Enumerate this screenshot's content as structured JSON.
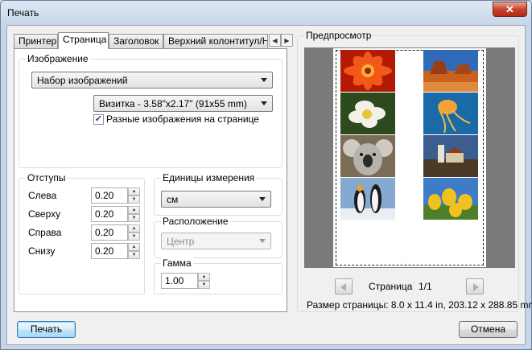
{
  "window": {
    "title": "Печать",
    "close_glyph": "✕"
  },
  "tabs": [
    {
      "label": "Принтер",
      "active": false
    },
    {
      "label": "Страница",
      "active": true
    },
    {
      "label": "Заголовок",
      "active": false
    },
    {
      "label": "Верхний колонтитул/Ни",
      "active": false
    }
  ],
  "image_group": {
    "label": "Изображение",
    "mode_value": "Набор изображений",
    "size_value": "Визитка - 3.58\"x2.17\" (91x55 mm)",
    "different_images_label": "Разные изображения на странице",
    "different_images_checked": true
  },
  "margins_group": {
    "label": "Отступы",
    "fields": [
      {
        "label": "Слева",
        "value": "0.20"
      },
      {
        "label": "Сверху",
        "value": "0.20"
      },
      {
        "label": "Справа",
        "value": "0.20"
      },
      {
        "label": "Снизу",
        "value": "0.20"
      }
    ]
  },
  "units_group": {
    "label": "Единицы измерения",
    "value": "см"
  },
  "position_group": {
    "label": "Расположение",
    "value": "Центр",
    "disabled": true
  },
  "gamma_group": {
    "label": "Гамма",
    "value": "1.00"
  },
  "preview": {
    "label": "Предпросмотр",
    "page_label": "Страница",
    "page_counter": "1/1",
    "page_size_text": "Размер страницы: 8.0 x 11.4 in, 203.12 x 288.85 mm",
    "thumbnails": [
      "red-flower",
      "desert",
      "white-flower",
      "jellyfish",
      "koala",
      "lighthouse",
      "penguins",
      "tulips"
    ]
  },
  "buttons": {
    "print": "Печать",
    "cancel": "Отмена"
  },
  "colors": {
    "accent": "#3c7fb1",
    "preview_bg": "#7a7a7a"
  }
}
